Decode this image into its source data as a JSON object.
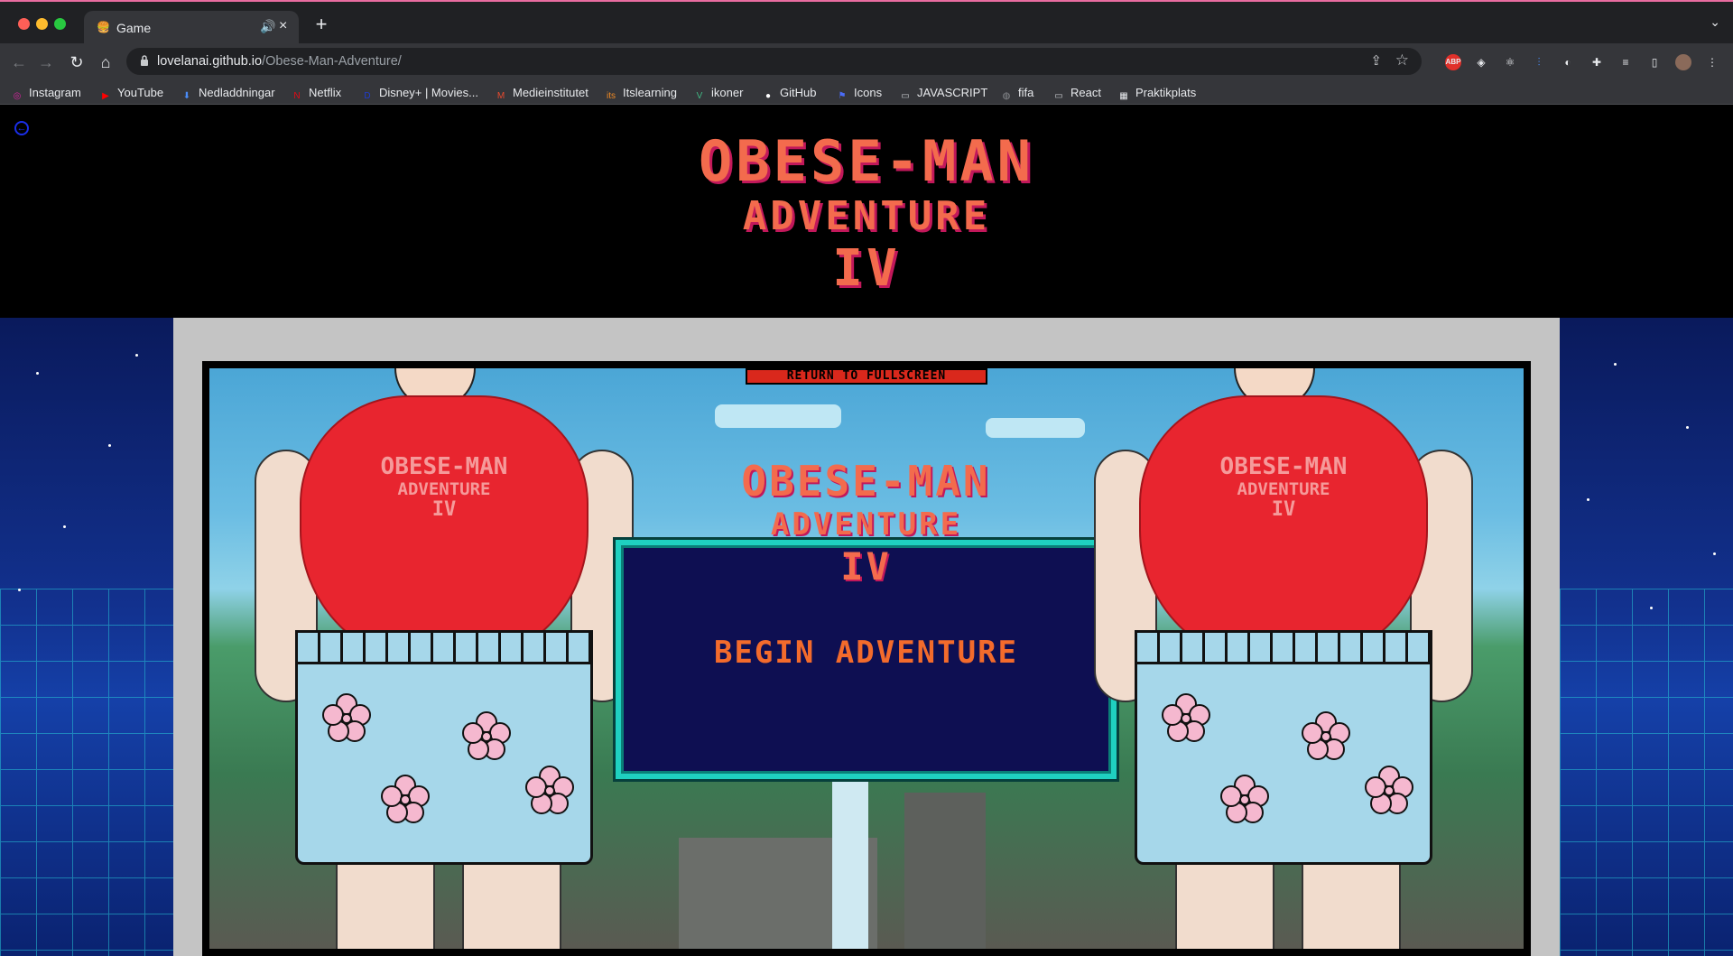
{
  "browser": {
    "tab_title": "Game",
    "tab_favicon": "🍔",
    "url_host": "lovelanai.github.io",
    "url_path": "/Obese-Man-Adventure/",
    "bookmarks": [
      {
        "label": "Instagram",
        "icon": "instagram-icon",
        "color": "#d6249f"
      },
      {
        "label": "YouTube",
        "icon": "youtube-icon",
        "color": "#ff0000"
      },
      {
        "label": "Nedladdningar",
        "icon": "download-icon",
        "color": "#4a8cf7"
      },
      {
        "label": "Netflix",
        "icon": "netflix-icon",
        "color": "#e50914"
      },
      {
        "label": "Disney+ | Movies...",
        "icon": "disney-icon",
        "color": "#1f3ccf"
      },
      {
        "label": "Medieinstitutet",
        "icon": "medieinstitutet-icon",
        "color": "#e84a2f"
      },
      {
        "label": "Itslearning",
        "icon": "itslearning-icon",
        "color": "#f08a24"
      },
      {
        "label": "ikoner",
        "icon": "vue-icon",
        "color": "#41b883"
      },
      {
        "label": "GitHub",
        "icon": "github-icon",
        "color": "#ffffff"
      },
      {
        "label": "Icons",
        "icon": "flag-icon",
        "color": "#4a6cf7"
      },
      {
        "label": "JAVASCRIPT",
        "icon": "folder-icon",
        "color": "#c8cacd"
      },
      {
        "label": "fifa",
        "icon": "globe-icon",
        "color": "#8a8c90"
      },
      {
        "label": "React",
        "icon": "folder-icon",
        "color": "#c8cacd"
      },
      {
        "label": "Praktikplats",
        "icon": "film-icon",
        "color": "#e8eaed"
      }
    ]
  },
  "page": {
    "header": {
      "line1": "OBESE-MAN",
      "line2": "ADVENTURE",
      "line3": "IV"
    },
    "game": {
      "fullscreen_label": "RETURN TO FULLSCREEN",
      "title_line1": "OBESE-MAN",
      "title_line2": "ADVENTURE",
      "title_line3": "IV",
      "begin_label": "BEGIN ADVENTURE",
      "shirt_line1": "OBESE-MAN",
      "shirt_line2": "ADVENTURE",
      "shirt_line3": "IV"
    }
  },
  "colors": {
    "title": "#f36b4d",
    "title_shadow": "#c2185b",
    "panel_bg": "#0e0f52",
    "panel_border": "#1fd0c0",
    "begin": "#f36b2c"
  }
}
